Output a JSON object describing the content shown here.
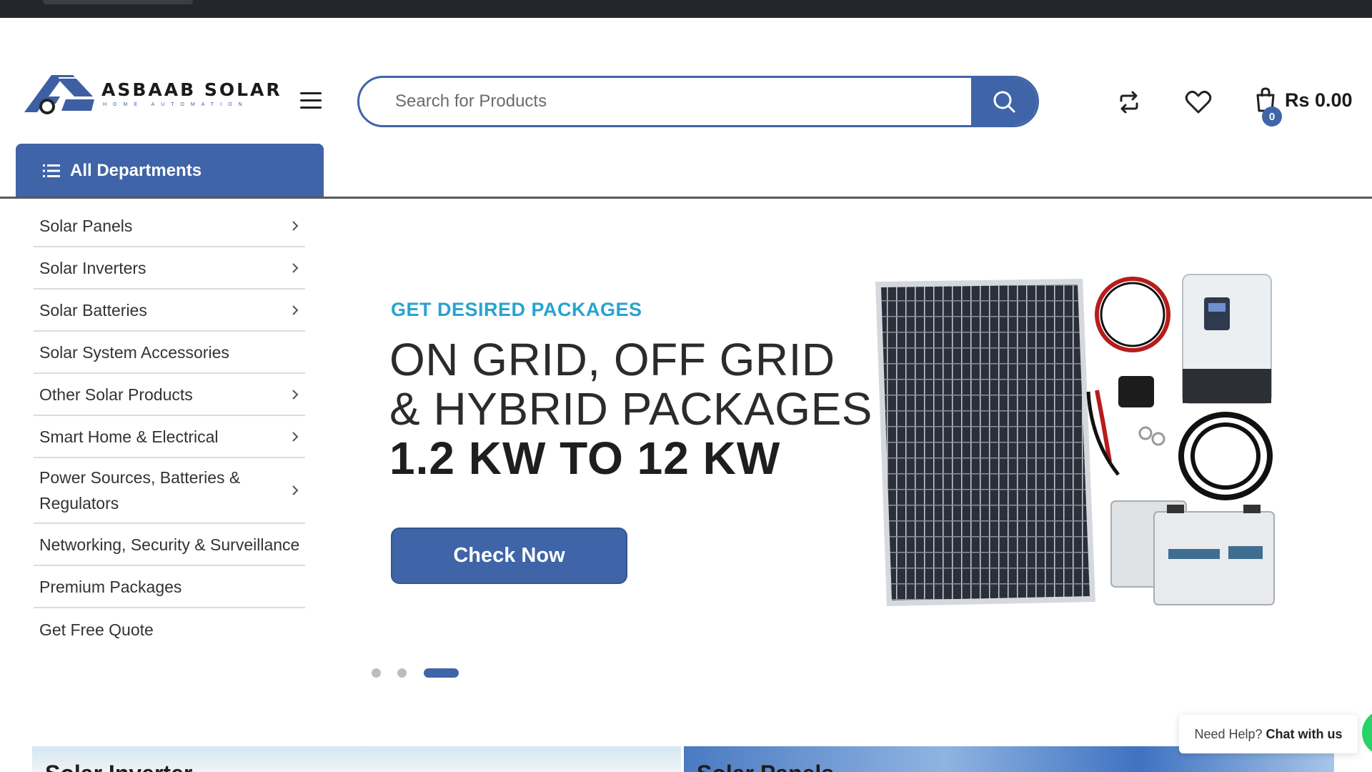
{
  "brand": {
    "name": "ASBAAB SOLAR",
    "tagline": "HOME AUTOMATION"
  },
  "header": {
    "search_placeholder": "Search for Products",
    "cart_total": "Rs 0.00",
    "cart_count": "0"
  },
  "departments": {
    "label": "All Departments",
    "items": [
      {
        "label": "Solar Panels",
        "has_submenu": true
      },
      {
        "label": "Solar Inverters",
        "has_submenu": true
      },
      {
        "label": "Solar Batteries",
        "has_submenu": true
      },
      {
        "label": "Solar System Accessories",
        "has_submenu": false
      },
      {
        "label": "Other Solar Products",
        "has_submenu": true
      },
      {
        "label": "Smart Home & Electrical",
        "has_submenu": true
      },
      {
        "label": "Power Sources, Batteries & Regulators",
        "has_submenu": true
      },
      {
        "label": "Networking, Security & Surveillance",
        "has_submenu": false
      },
      {
        "label": "Premium Packages",
        "has_submenu": false
      },
      {
        "label": "Get Free Quote",
        "has_submenu": false
      }
    ]
  },
  "hero": {
    "tagline": "GET DESIRED PACKAGES",
    "line1": "ON GRID, OFF GRID",
    "line2": "& HYBRID PACKAGES",
    "line3": "1.2 KW TO 12 KW",
    "cta": "Check Now",
    "slide_count": 3,
    "active_slide": 3
  },
  "banners": [
    {
      "title": "Solar Inverter"
    },
    {
      "title": "Solar Panels"
    }
  ],
  "help": {
    "prefix": "Need Help?",
    "link": "Chat with us"
  },
  "colors": {
    "primary": "#3f64a8",
    "accent": "#29a3cf",
    "topbar": "#23272b"
  },
  "icons": [
    "menu-icon",
    "search-icon",
    "compare-icon",
    "heart-icon",
    "cart-icon",
    "list-icon",
    "chevron-right-icon",
    "whatsapp-icon"
  ]
}
